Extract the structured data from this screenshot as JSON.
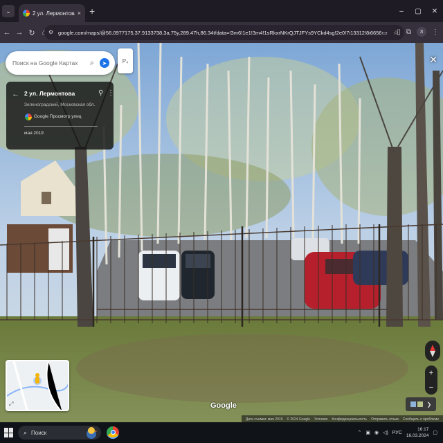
{
  "browser": {
    "tab_title": "2 ул. Лермонтова – Google Ка...",
    "tab_close": "×",
    "new_tab": "+",
    "tab_list_icon": "⌄",
    "window_controls": {
      "minimize": "–",
      "maximize": "▢",
      "close": "✕"
    },
    "url": "google.com/maps/@56.0977175,37.9133738,3a,75y,289.47h,86.34t/data=!3m6!1e1!3m4!1sRkxrNKrQJTJFYs9YCkd4sg!2e0!7i13312!8i6656?hl=ru&entry=ttu",
    "profile_initial": "З"
  },
  "maps": {
    "search_placeholder": "Поиск на Google Картах",
    "apps_label": "Р₄",
    "card": {
      "title": "2 ул. Лермонтова",
      "subtitle": "Зеленоградский, Московская обл.",
      "provider": "Google Просмотр улиц",
      "date": "мая 2019"
    },
    "watermark": "Google",
    "attribution": [
      "Дата съемки: мая 2019",
      "© 2024 Google",
      "Условия",
      "Конфиденциальность",
      "Отправить отзыв",
      "Сообщить о проблеме"
    ]
  },
  "taskbar": {
    "search_text": "Поиск",
    "language": "РУС",
    "time": "16:17",
    "date": "16.03.2024"
  },
  "colors": {
    "accent": "#1a73e8",
    "tab_bg": "#35303b",
    "taskbar": "#101318"
  }
}
